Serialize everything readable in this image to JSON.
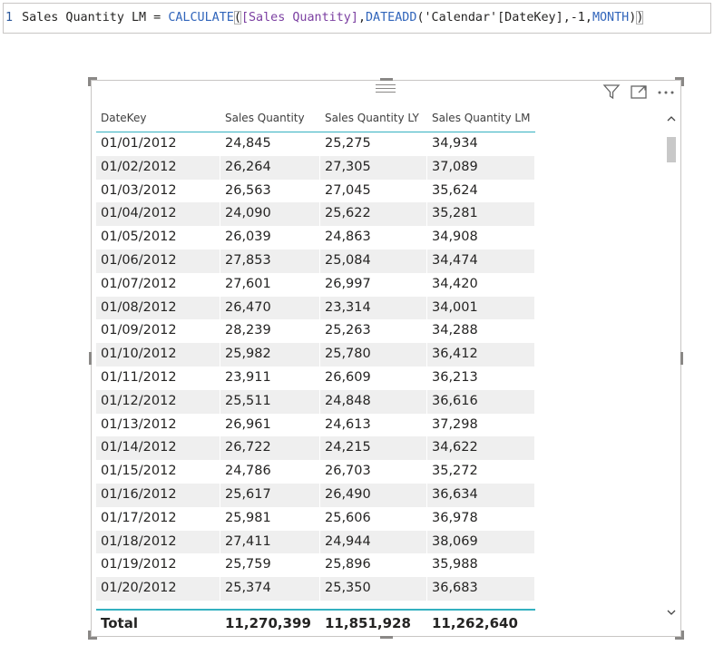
{
  "formula": {
    "line_number": "1",
    "part1": "Sales Quantity LM = ",
    "func1": "CALCULATE",
    "paren_open": "(",
    "measure": "[Sales Quantity]",
    "comma1": ",",
    "func2": "DATEADD",
    "paren2_open": "(",
    "table_ref": "'Calendar'[DateKey]",
    "args": ",-1,",
    "keyword": "MONTH",
    "paren2_close": ")",
    "paren_close": ")"
  },
  "toolbar": {
    "filter_icon": "filter-icon",
    "focus_icon": "focus-mode-icon",
    "more_icon": "more-options-icon"
  },
  "table": {
    "headers": [
      "DateKey",
      "Sales Quantity",
      "Sales Quantity LY",
      "Sales Quantity LM"
    ],
    "rows": [
      [
        "01/01/2012",
        "24,845",
        "25,275",
        "34,934"
      ],
      [
        "01/02/2012",
        "26,264",
        "27,305",
        "37,089"
      ],
      [
        "01/03/2012",
        "26,563",
        "27,045",
        "35,624"
      ],
      [
        "01/04/2012",
        "24,090",
        "25,622",
        "35,281"
      ],
      [
        "01/05/2012",
        "26,039",
        "24,863",
        "34,908"
      ],
      [
        "01/06/2012",
        "27,853",
        "25,084",
        "34,474"
      ],
      [
        "01/07/2012",
        "27,601",
        "26,997",
        "34,420"
      ],
      [
        "01/08/2012",
        "26,470",
        "23,314",
        "34,001"
      ],
      [
        "01/09/2012",
        "28,239",
        "25,263",
        "34,288"
      ],
      [
        "01/10/2012",
        "25,982",
        "25,780",
        "36,412"
      ],
      [
        "01/11/2012",
        "23,911",
        "26,609",
        "36,213"
      ],
      [
        "01/12/2012",
        "25,511",
        "24,848",
        "36,616"
      ],
      [
        "01/13/2012",
        "26,961",
        "24,613",
        "37,298"
      ],
      [
        "01/14/2012",
        "26,722",
        "24,215",
        "34,622"
      ],
      [
        "01/15/2012",
        "24,786",
        "26,703",
        "35,272"
      ],
      [
        "01/16/2012",
        "25,617",
        "26,490",
        "36,634"
      ],
      [
        "01/17/2012",
        "25,981",
        "25,606",
        "36,978"
      ],
      [
        "01/18/2012",
        "27,411",
        "24,944",
        "38,069"
      ],
      [
        "01/19/2012",
        "25,759",
        "25,896",
        "35,988"
      ],
      [
        "01/20/2012",
        "25,374",
        "25,350",
        "36,683"
      ]
    ],
    "total": [
      "Total",
      "11,270,399",
      "11,851,928",
      "11,262,640"
    ]
  },
  "scroll": {
    "up_glyph": "^",
    "down_glyph": "v"
  },
  "colors": {
    "accent": "#34b1c0",
    "row_alt": "#efefef"
  }
}
